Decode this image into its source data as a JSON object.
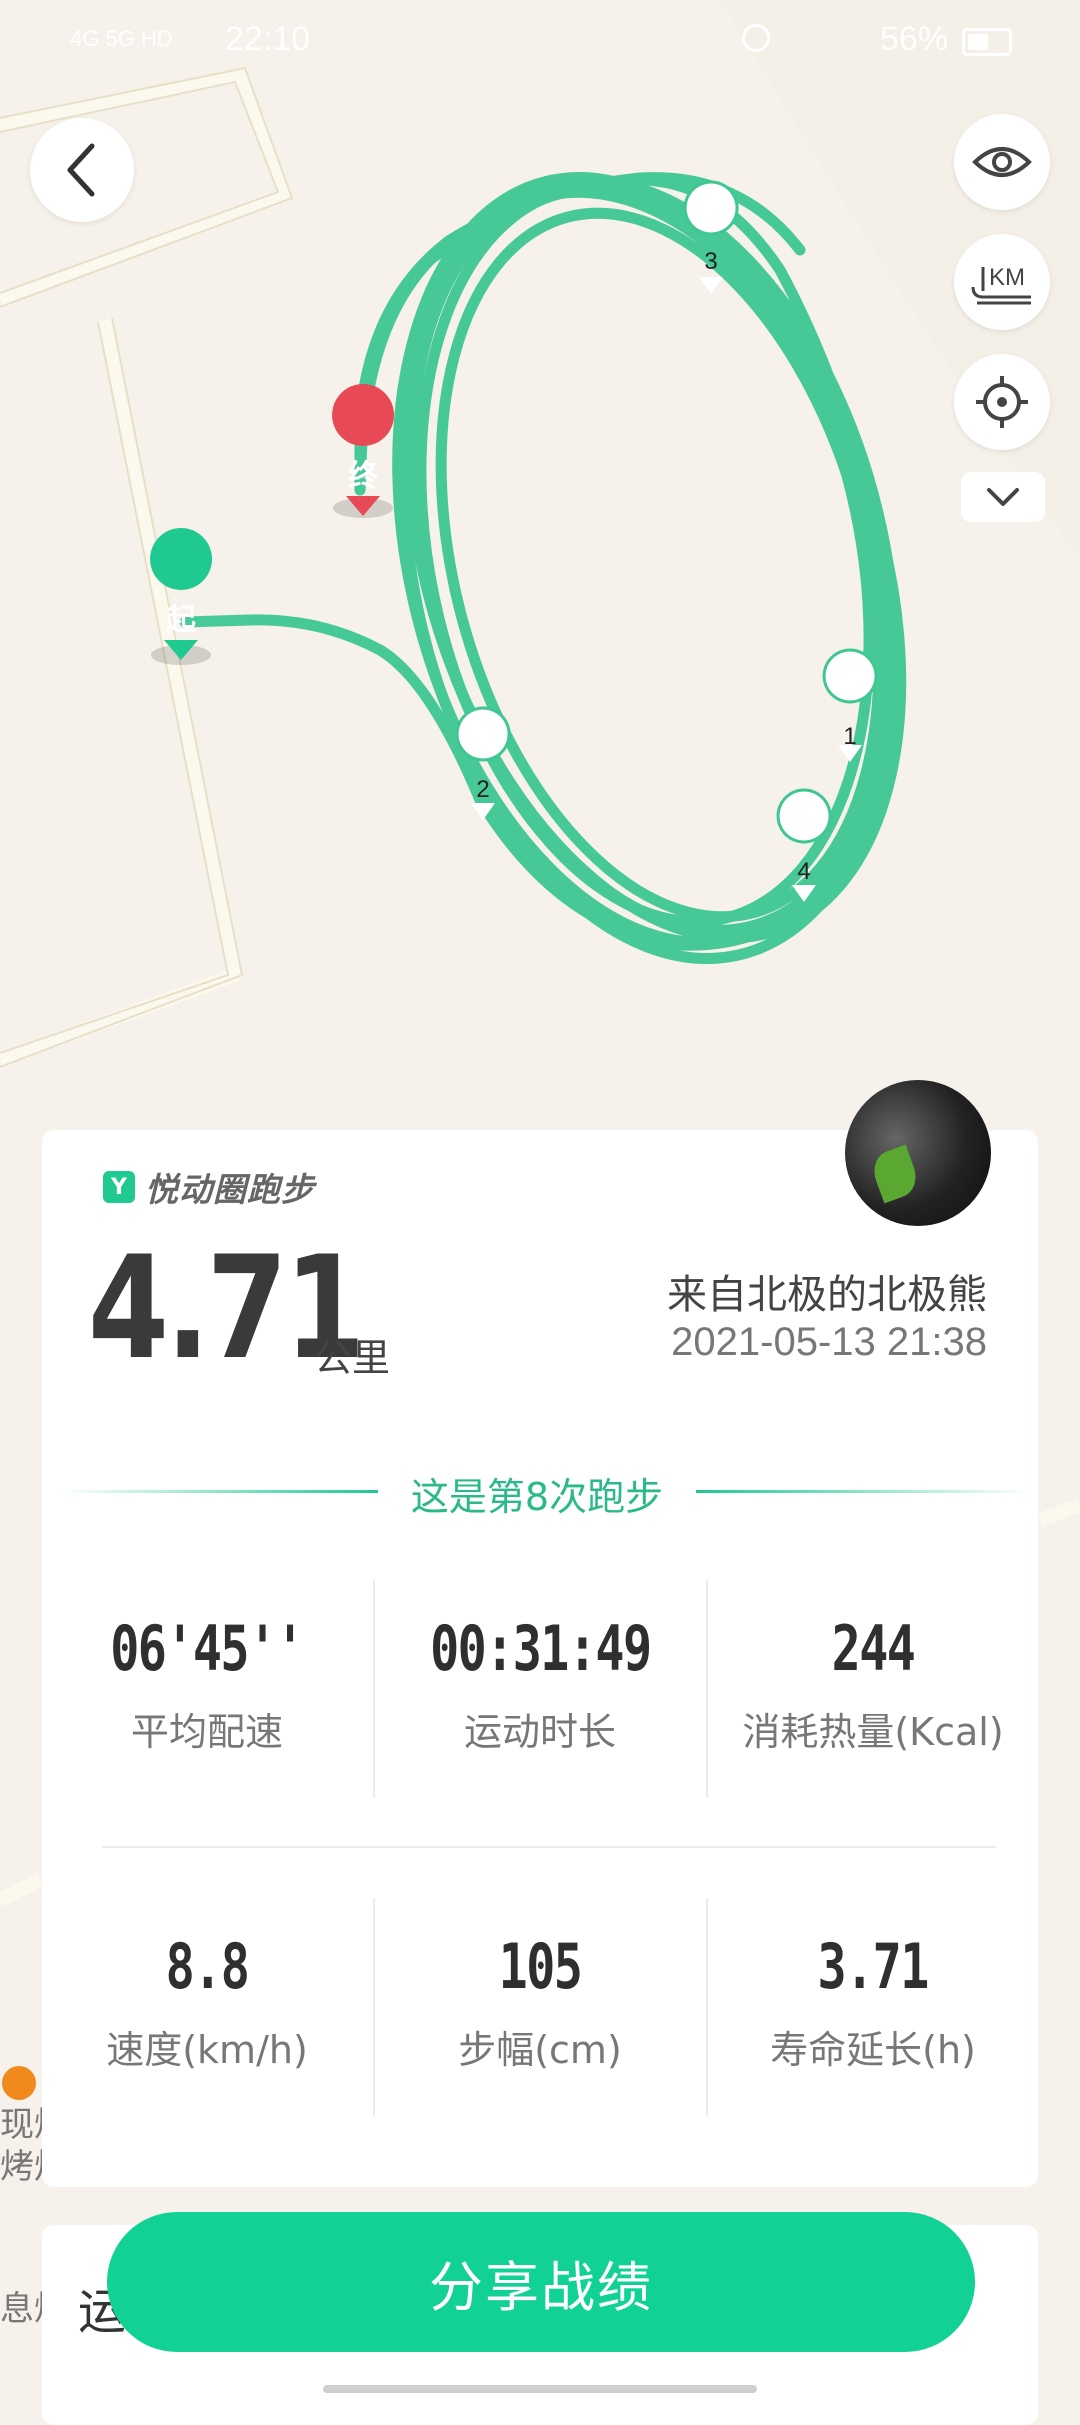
{
  "status_bar": {
    "signal": "4G 5G HD",
    "time": "22:10",
    "battery": "56%"
  },
  "map": {
    "start_label": "起",
    "end_label": "终",
    "km_markers": [
      "1",
      "2",
      "3",
      "4"
    ],
    "poi_text": [
      "现烤",
      "烤炉",
      "息烤"
    ],
    "route_color": "#3ec693"
  },
  "controls": {
    "km_label": "KM"
  },
  "summary": {
    "app_name": "悦动圈跑步",
    "distance": "4.71",
    "distance_unit": "公里",
    "username": "来自北极的北极熊",
    "datetime": "2021-05-13 21:38",
    "run_count_text": "这是第8次跑步"
  },
  "stats": [
    {
      "value": "06'45''",
      "label": "平均配速"
    },
    {
      "value": "00:31:49",
      "label": "运动时长"
    },
    {
      "value": "244",
      "label": "消耗热量(Kcal)"
    },
    {
      "value": "8.8",
      "label": "速度(km/h)"
    },
    {
      "value": "105",
      "label": "步幅(cm)"
    },
    {
      "value": "3.71",
      "label": "寿命延长(h)"
    }
  ],
  "lower_card_peek": "运",
  "share_button": "分享战绩",
  "colors": {
    "accent": "#12d195",
    "route": "#3ec693",
    "end_marker": "#e84a55",
    "start_marker": "#1fc98f"
  }
}
